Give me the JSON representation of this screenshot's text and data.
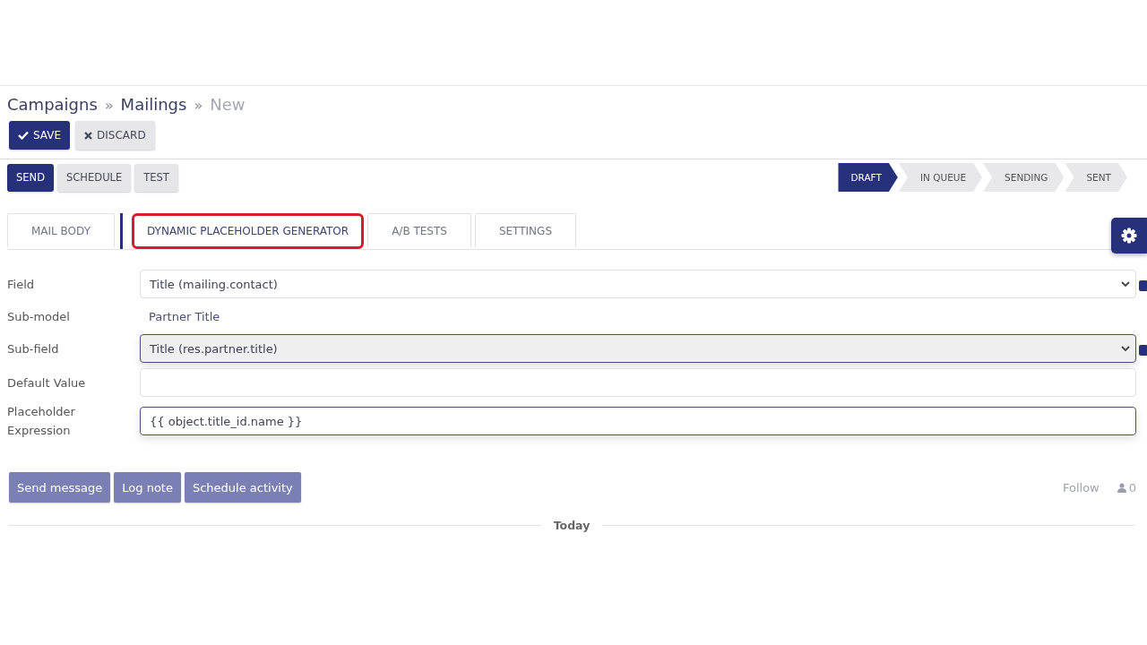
{
  "breadcrumb": [
    {
      "label": "Campaigns",
      "current": false
    },
    {
      "label": "Mailings",
      "current": false
    },
    {
      "label": "New",
      "current": true
    }
  ],
  "separator": "»",
  "control_buttons": [
    {
      "label": "SAVE",
      "kind": "primary"
    },
    {
      "label": "DISCARD",
      "kind": "secondary"
    }
  ],
  "header_buttons": [
    {
      "label": "SEND",
      "kind": "primary"
    },
    {
      "label": "SCHEDULE",
      "kind": "secondary"
    },
    {
      "label": "TEST",
      "kind": "secondary"
    }
  ],
  "stages": [
    {
      "label": "DRAFT",
      "selected": true
    },
    {
      "label": "IN QUEUE",
      "selected": false
    },
    {
      "label": "SENDING",
      "selected": false
    },
    {
      "label": "SENT",
      "selected": false
    }
  ],
  "tabs": [
    {
      "label": "MAIL BODY",
      "selected": false
    },
    {
      "label": "DYNAMIC PLACEHOLDER GENERATOR",
      "selected": true
    },
    {
      "label": "A/B TESTS",
      "selected": false
    },
    {
      "label": "SETTINGS",
      "selected": false
    }
  ],
  "fields": [
    {
      "label": "Field",
      "kind": "select",
      "value": "Title (mailing.contact)",
      "focused": false
    },
    {
      "label": "Sub-model",
      "kind": "readonly",
      "value": "Partner Title"
    },
    {
      "label": "Sub-field",
      "kind": "select",
      "value": "Title (res.partner.title)",
      "focused": true
    },
    {
      "label": "Default Value",
      "kind": "input",
      "focused": false
    },
    {
      "label": "Placeholder Expression",
      "kind": "input",
      "value": "{{ object.title_id.name }}",
      "focused": true
    }
  ],
  "chatter": {
    "buttons": [
      "Send message",
      "Log note",
      "Schedule activity"
    ],
    "follow": "Follow",
    "followers": "0",
    "date_separator": "Today"
  }
}
